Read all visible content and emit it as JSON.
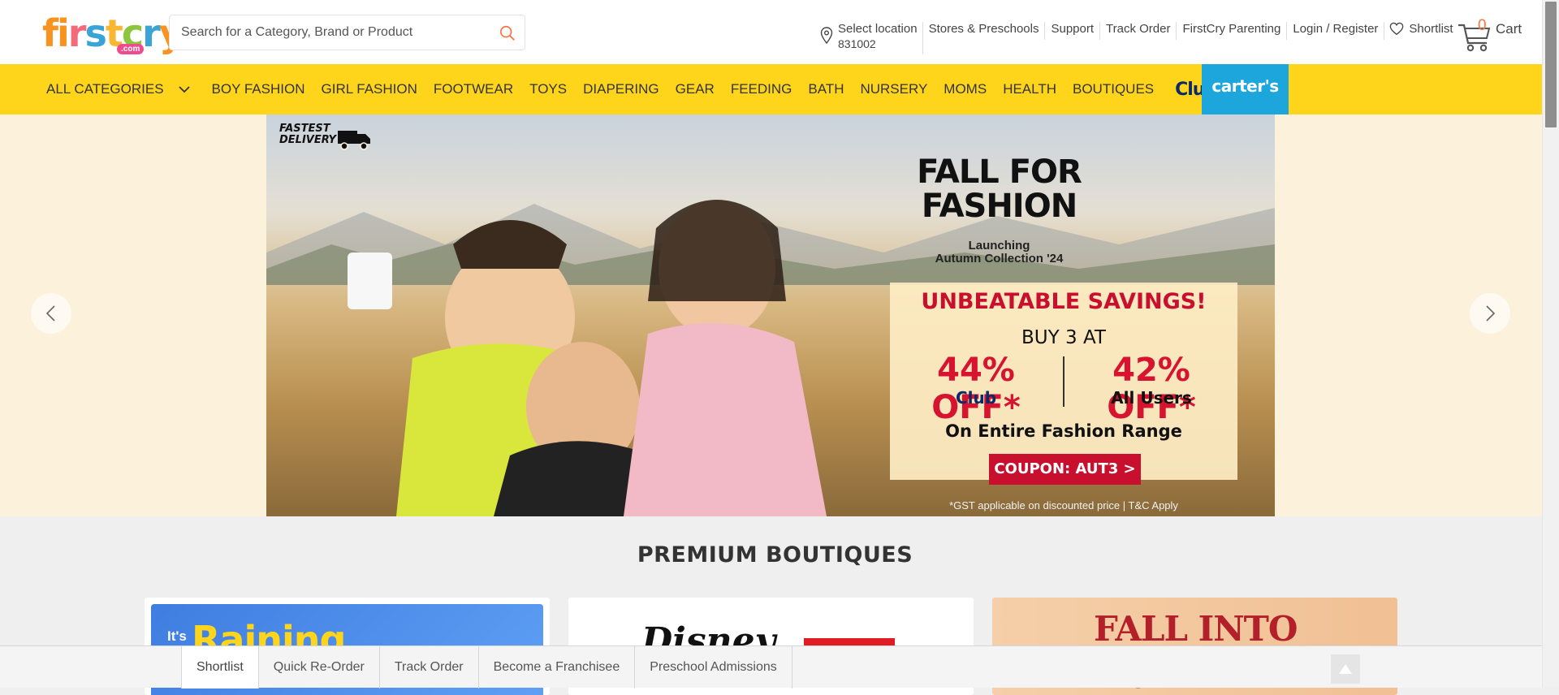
{
  "header": {
    "logo_text": "firstcry",
    "logo_sub": ".com",
    "search_placeholder": "Search for a Category, Brand or Product",
    "location_label": "Select location",
    "location_zip": "831002",
    "links": [
      "Stores & Preschools",
      "Support",
      "Track Order",
      "FirstCry Parenting",
      "Login / Register"
    ],
    "shortlist_label": "Shortlist",
    "cart_count": "0",
    "cart_label": "Cart"
  },
  "nav": {
    "all_categories": "ALL CATEGORIES",
    "items": [
      "BOY FASHION",
      "GIRL FASHION",
      "FOOTWEAR",
      "TOYS",
      "DIAPERING",
      "GEAR",
      "FEEDING",
      "BATH",
      "NURSERY",
      "MOMS",
      "HEALTH",
      "BOUTIQUES"
    ],
    "club_logo": "Club",
    "carters_logo": "carter's"
  },
  "banner": {
    "fastest": "FASTEST",
    "delivery": "DELIVERY",
    "title_line1": "FALL FOR",
    "title_line2": "FASHION",
    "subtitle1": "Launching",
    "subtitle2": "Autumn Collection '24",
    "headline": "UNBEATABLE SAVINGS!",
    "buy": "BUY 3 AT",
    "offer1": "44% OFF*",
    "offer1_label": "Club",
    "offer2": "42% OFF*",
    "offer2_label": "All Users",
    "range": "On Entire Fashion Range",
    "coupon": "COUPON: AUT3 >",
    "disclaimer": "*GST applicable on discounted price | T&C Apply"
  },
  "boutiques": {
    "title": "PREMIUM BOUTIQUES",
    "card1_small": "It's",
    "card1_text": "Raining",
    "card2_text": "Disney",
    "card3_text": "FALL INTO Style"
  },
  "bottom_bar": {
    "links": [
      "Shortlist",
      "Quick Re-Order",
      "Track Order",
      "Become a Franchisee",
      "Preschool Admissions"
    ]
  },
  "colors": {
    "nav_yellow": "#ffd51c",
    "carters_blue": "#1da6dc",
    "accent_red": "#c8102e",
    "banner_bg": "#fcf1db"
  }
}
